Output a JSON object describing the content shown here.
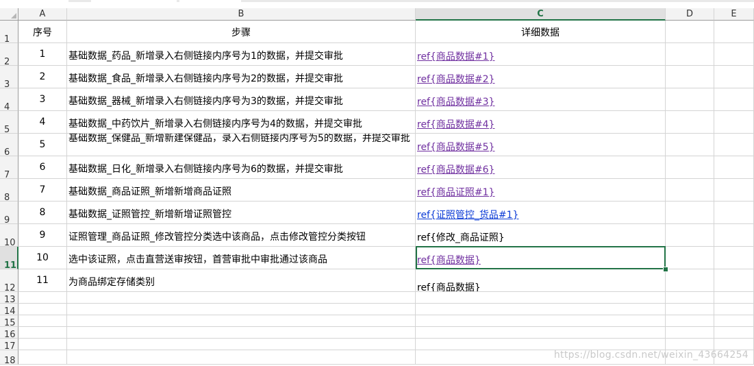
{
  "columns": [
    "A",
    "B",
    "C",
    "D",
    "E"
  ],
  "selected_column": "C",
  "row_numbers": [
    "1",
    "2",
    "3",
    "4",
    "5",
    "6",
    "7",
    "8",
    "9",
    "10",
    "11",
    "12",
    "13",
    "14",
    "15",
    "16",
    "17",
    "18"
  ],
  "selected_row": "11",
  "header": {
    "a": "序号",
    "b": "步骤",
    "c": "详细数据"
  },
  "rows": [
    {
      "num": "1",
      "step": "基础数据_药品_新增录入右侧链接内序号为1的数据，并提交审批",
      "detail": "ref{商品数据#1}",
      "style": "purple"
    },
    {
      "num": "2",
      "step": "基础数据_食品_新增录入右侧链接内序号为2的数据，并提交审批",
      "detail": "ref{商品数据#2}",
      "style": "purple"
    },
    {
      "num": "3",
      "step": "基础数据_器械_新增录入右侧链接内序号为3的数据，并提交审批",
      "detail": "ref{商品数据#3}",
      "style": "purple"
    },
    {
      "num": "4",
      "step": "基础数据_中药饮片_新增录入右侧链接内序号为4的数据，并提交审批",
      "detail": "ref{商品数据#4}",
      "style": "purple"
    },
    {
      "num": "5",
      "step": "基础数据_保健品_新增新建保健品，录入右侧链接内序号为5的数据，并提交审批",
      "detail": "ref{商品数据#5}",
      "style": "purple"
    },
    {
      "num": "6",
      "step": "基础数据_日化_新增录入右侧链接内序号为6的数据，并提交审批",
      "detail": "ref{商品数据#6}",
      "style": "purple"
    },
    {
      "num": "7",
      "step": "基础数据_商品证照_新增新增商品证照",
      "detail": "ref{商品证照#1}",
      "style": "purple"
    },
    {
      "num": "8",
      "step": "基础数据_证照管控_新增新增证照管控",
      "detail": "ref{证照管控_货品#1}",
      "style": "blue"
    },
    {
      "num": "9",
      "step": "证照管理_商品证照_修改管控分类选中该商品，点击修改管控分类按钮",
      "detail": "ref{修改_商品证照}",
      "style": "plain"
    },
    {
      "num": "10",
      "step": "选中该证照，点击直营送审按钮，首营审批中审批通过该商品",
      "detail": "ref{商品数据}",
      "style": "purple"
    },
    {
      "num": "11",
      "step": "为商品绑定存储类别",
      "detail": "ref{商品数据}",
      "style": "plain"
    }
  ],
  "watermark": "https://blog.csdn.net/weixin_43664254"
}
